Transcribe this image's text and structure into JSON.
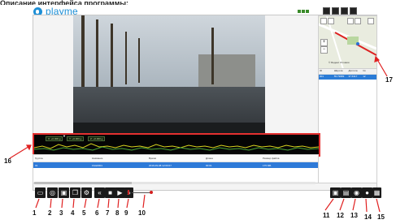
{
  "header": {
    "top_cut_text": "Описание интерфейса программы:",
    "brand": "playme"
  },
  "colors": {
    "brand": "#1d8fd6",
    "highlight_border": "#e53030",
    "selected_row": "#2e7ad8",
    "toolbar_icon_bg": "#1a1a1a"
  },
  "map": {
    "zoom_in": "+",
    "zoom_out": "−",
    "caption": "© Яндекс  Условия"
  },
  "gps_table": {
    "columns": [
      "ID",
      "Широта",
      "Долгота",
      "Ск"
    ],
    "row": [
      "001",
      "55.79983",
      "37.6317",
      "12"
    ]
  },
  "graph": {
    "legends": [
      "X: +0.000 g",
      "Y: +0.000 g",
      "Z: +0.000 g"
    ]
  },
  "file_table": {
    "columns": [
      "Группа",
      "Название",
      "Время",
      "Длина",
      "Размер файла"
    ],
    "row": [
      "01",
      "FILE0001",
      "2016-09-08 12:00:07",
      "00:01",
      "175 МБ"
    ]
  },
  "input_hint": "",
  "toolbar_left": [
    {
      "id": "1",
      "icon": "folder-icon",
      "glyph": "▭"
    },
    {
      "id": "2",
      "icon": "camera-icon",
      "glyph": "◎"
    },
    {
      "id": "3",
      "icon": "save-icon",
      "glyph": "▣"
    },
    {
      "id": "4",
      "icon": "copy-icon",
      "glyph": "❐"
    },
    {
      "id": "5",
      "icon": "settings-icon",
      "glyph": "⚙"
    },
    {
      "id": "6",
      "icon": "previous-icon",
      "glyph": "«"
    },
    {
      "id": "7",
      "icon": "stop-icon",
      "glyph": "■"
    },
    {
      "id": "8",
      "icon": "play-icon",
      "glyph": "▶"
    },
    {
      "id": "9",
      "icon": "next-icon",
      "glyph": "»"
    }
  ],
  "volume_callout": "10",
  "toolbar_right": [
    {
      "id": "11",
      "icon": "fullscreen-icon",
      "glyph": "▣"
    },
    {
      "id": "12",
      "icon": "document-icon",
      "glyph": "▤"
    },
    {
      "id": "13",
      "icon": "snapshot-icon",
      "glyph": "◉"
    },
    {
      "id": "14",
      "icon": "lens-icon",
      "glyph": "●"
    },
    {
      "id": "15",
      "icon": "display-icon",
      "glyph": "▦"
    }
  ],
  "callouts": {
    "graph": "16",
    "map": "17"
  }
}
